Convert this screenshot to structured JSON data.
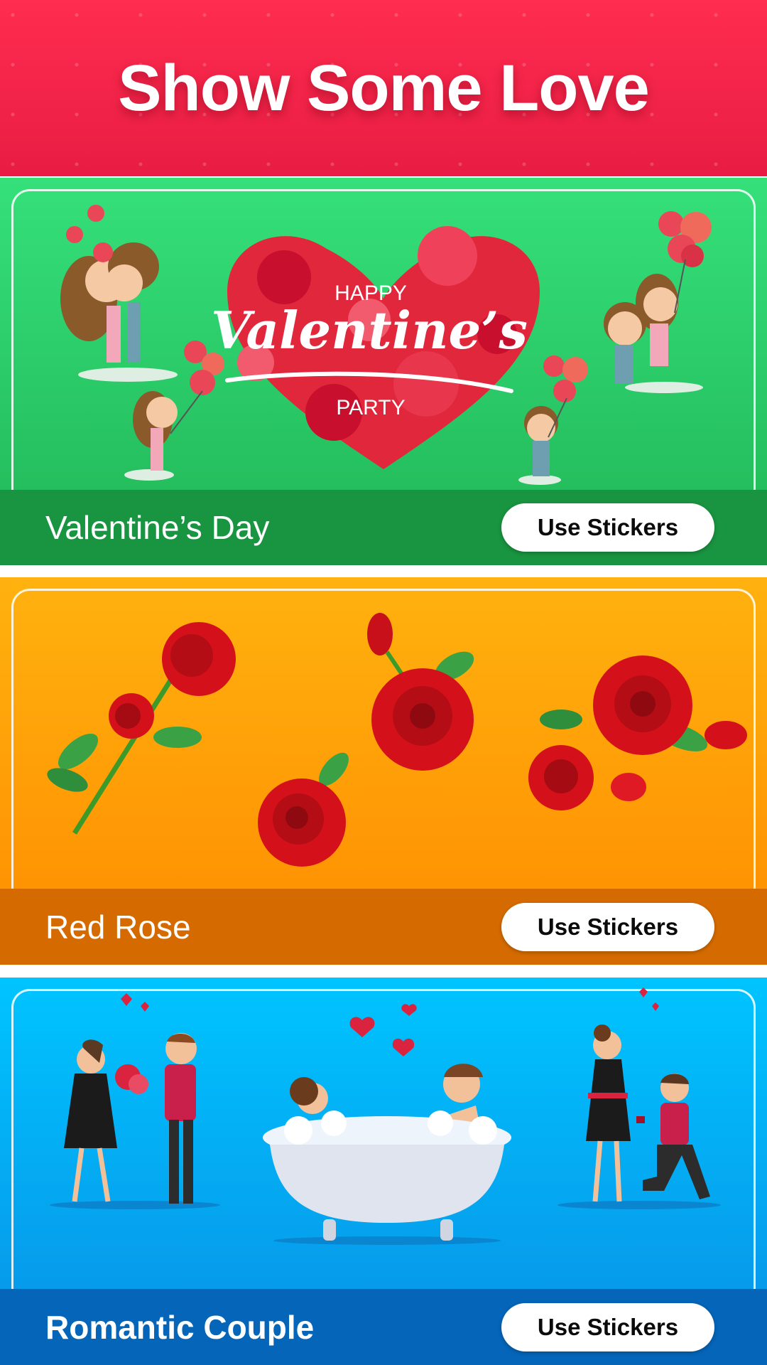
{
  "header": {
    "title": "Show Some Love"
  },
  "cards": [
    {
      "name": "Valentine’s Day",
      "button_label": "Use Stickers",
      "art": {
        "line1": "HAPPY",
        "line2": "Valentine’s",
        "line3": "PARTY"
      }
    },
    {
      "name": "Red Rose",
      "button_label": "Use Stickers"
    },
    {
      "name": "Romantic Couple",
      "button_label": "Use Stickers"
    }
  ],
  "colors": {
    "header": "#ff2d4f",
    "valentine_card": "#2bcf69",
    "rose_card": "#ffa100",
    "couple_card": "#00b0f5",
    "button": "#ffffff"
  }
}
